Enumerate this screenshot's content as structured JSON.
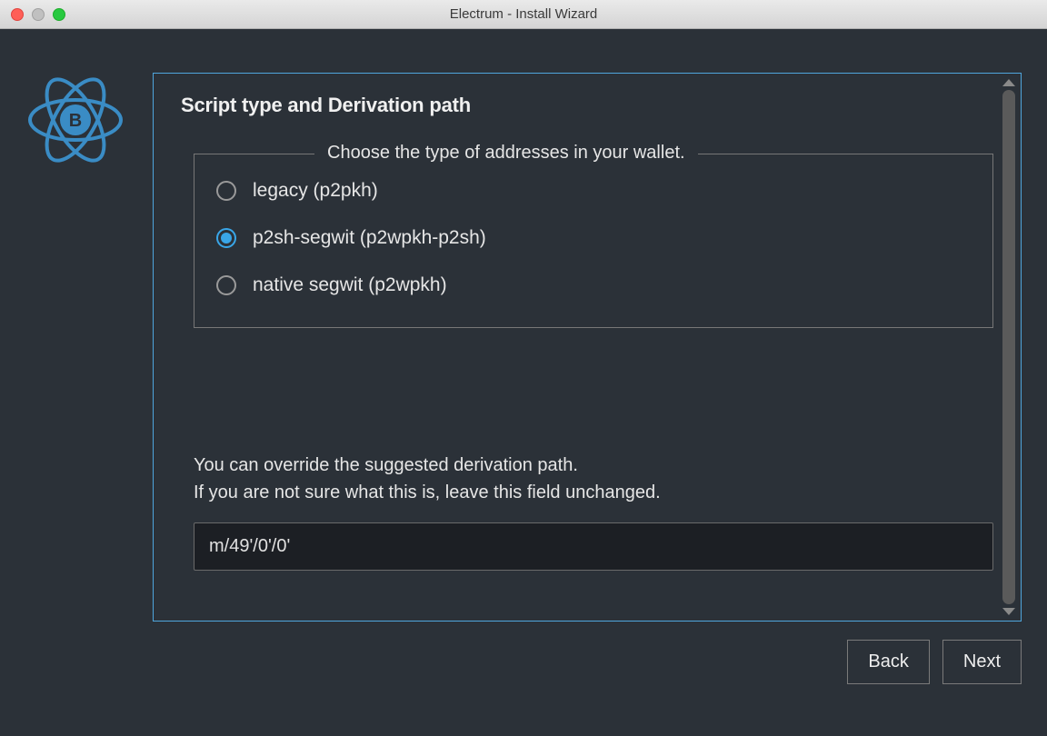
{
  "titlebar": {
    "title": "Electrum  -  Install Wizard"
  },
  "panel": {
    "heading": "Script type and Derivation path",
    "fieldset_legend": "Choose the type of addresses in your wallet.",
    "options": [
      {
        "label": "legacy (p2pkh)",
        "selected": false
      },
      {
        "label": "p2sh-segwit (p2wpkh-p2sh)",
        "selected": true
      },
      {
        "label": "native segwit (p2wpkh)",
        "selected": false
      }
    ],
    "help_line1": "You can override the suggested derivation path.",
    "help_line2": "If you are not sure what this is, leave this field unchanged.",
    "derivation_path": "m/49'/0'/0'"
  },
  "buttons": {
    "back": "Back",
    "next": "Next"
  }
}
